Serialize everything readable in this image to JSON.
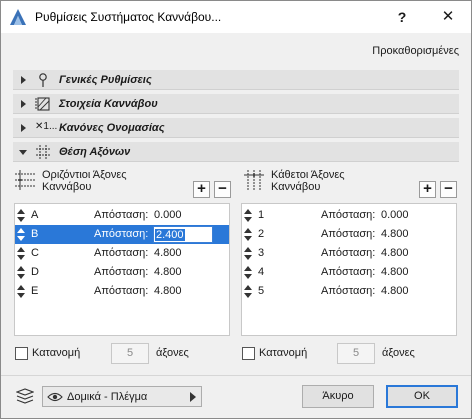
{
  "window": {
    "title": "Ρυθμίσεις Συστήματος Καννάβου...",
    "help": "?",
    "close": "✕"
  },
  "presets_label": "Προκαθορισμένες",
  "sections": [
    {
      "label": "Γενικές Ρυθμίσεις",
      "icon": "pin-icon",
      "expanded": false
    },
    {
      "label": "Στοιχεία Καννάβου",
      "icon": "grid-element-icon",
      "expanded": false
    },
    {
      "label": "Κανόνες Ονομασίας",
      "icon": "naming-icon",
      "icon_text": "✕1...",
      "expanded": false
    },
    {
      "label": "Θέση Αξόνων",
      "icon": "grid-axes-icon",
      "expanded": true
    }
  ],
  "horizontal": {
    "title_line1": "Οριζόντιοι Άξονες",
    "title_line2": "Καννάβου",
    "add": "+",
    "remove": "−",
    "rows": [
      {
        "name": "A",
        "dist_label": "Απόσταση:",
        "value": "0.000",
        "selected": false
      },
      {
        "name": "B",
        "dist_label": "Απόσταση:",
        "value": "2.400",
        "selected": true
      },
      {
        "name": "C",
        "dist_label": "Απόσταση:",
        "value": "4.800",
        "selected": false
      },
      {
        "name": "D",
        "dist_label": "Απόσταση:",
        "value": "4.800",
        "selected": false
      },
      {
        "name": "E",
        "dist_label": "Απόσταση:",
        "value": "4.800",
        "selected": false
      }
    ],
    "distribution_label": "Κατανομή",
    "distribution_count": "5",
    "unit": "άξονες"
  },
  "vertical": {
    "title_line1": "Κάθετοι Άξονες",
    "title_line2": "Καννάβου",
    "add": "+",
    "remove": "−",
    "rows": [
      {
        "name": "1",
        "dist_label": "Απόσταση:",
        "value": "0.000"
      },
      {
        "name": "2",
        "dist_label": "Απόσταση:",
        "value": "4.800"
      },
      {
        "name": "3",
        "dist_label": "Απόσταση:",
        "value": "4.800"
      },
      {
        "name": "4",
        "dist_label": "Απόσταση:",
        "value": "4.800"
      },
      {
        "name": "5",
        "dist_label": "Απόσταση:",
        "value": "4.800"
      }
    ],
    "distribution_label": "Κατανομή",
    "distribution_count": "5",
    "unit": "άξονες"
  },
  "footer": {
    "layer_label": "Δομικά - Πλέγμα",
    "cancel": "Άκυρο",
    "ok": "OK"
  },
  "colors": {
    "selection": "#2a78d8",
    "dialog_bg": "#f0f0f0",
    "section_bg": "#e2e2e2"
  }
}
